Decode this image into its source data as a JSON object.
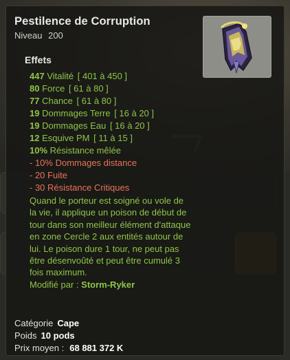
{
  "item": {
    "name": "Pestilence de Corruption",
    "level_label": "Niveau",
    "level_value": "200",
    "icon": "cape-icon"
  },
  "effects_title": "Effets",
  "effects": [
    {
      "num": "447",
      "label": "Vitalité",
      "range": "[ 401 à 450 ]",
      "kind": "pos"
    },
    {
      "num": "80",
      "label": "Force",
      "range": "[ 61 à 80 ]",
      "kind": "pos"
    },
    {
      "num": "77",
      "label": "Chance",
      "range": "[ 61 à 80 ]",
      "kind": "pos"
    },
    {
      "num": "19",
      "label": "Dommages Terre",
      "range": "[ 16 à 20 ]",
      "kind": "pos"
    },
    {
      "num": "19",
      "label": "Dommages Eau",
      "range": "[ 16 à 20 ]",
      "kind": "pos"
    },
    {
      "num": "12",
      "label": "Esquive PM",
      "range": "[ 11 à 15 ]",
      "kind": "pos"
    },
    {
      "num": "10%",
      "label": "Résistance mêlée",
      "range": "",
      "kind": "pos"
    },
    {
      "num": "- 10%",
      "label": "Dommages distance",
      "range": "",
      "kind": "neg"
    },
    {
      "num": "- 20",
      "label": "Fuite",
      "range": "",
      "kind": "neg"
    },
    {
      "num": "- 30",
      "label": "Résistance Critiques",
      "range": "",
      "kind": "neg"
    }
  ],
  "description": "Quand le porteur est soigné ou vole de la vie, il applique un poison de début de tour dans son meilleur élément d'attaque en zone Cercle 2 aux entités autour de lui. Le poison dure 1 tour, ne peut pas être désenvoûté et peut être cumulé 3 fois maximum.",
  "modified_by_label": "Modifié par :",
  "modified_by": "Storm-Ryker",
  "meta": {
    "category_label": "Catégorie",
    "category": "Cape",
    "weight_label": "Poids",
    "weight": "10 pods",
    "price_label": "Prix moyen :",
    "price": "68 881 372 K"
  },
  "colors": {
    "positive": "#8ec548",
    "negative": "#e8745a",
    "title": "#e8e8e8"
  }
}
